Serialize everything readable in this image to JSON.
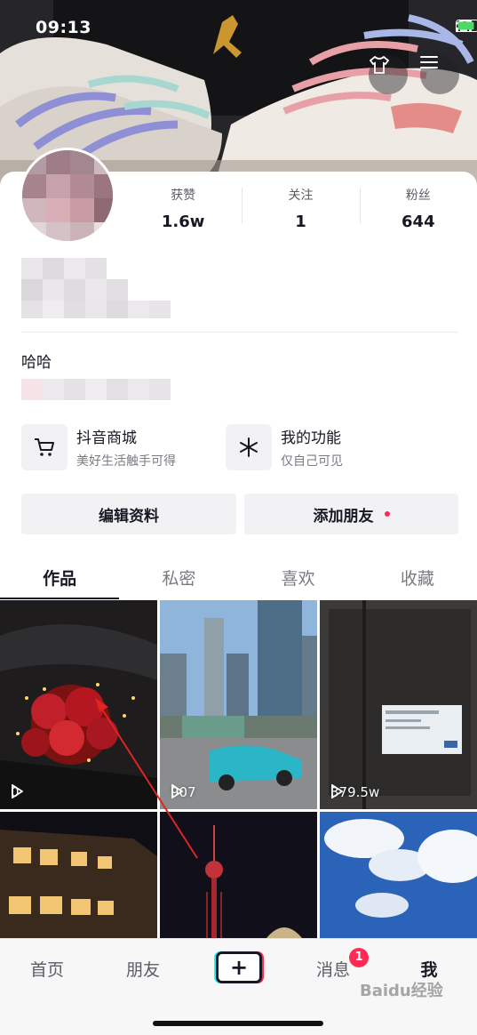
{
  "status_bar": {
    "time": "09:13"
  },
  "profile": {
    "stats": [
      {
        "label": "获赞",
        "value": "1.6w"
      },
      {
        "label": "关注",
        "value": "1"
      },
      {
        "label": "粉丝",
        "value": "644"
      }
    ],
    "bio_title": "哈哈"
  },
  "features": [
    {
      "icon": "cart-icon",
      "title": "抖音商城",
      "subtitle": "美好生活触手可得"
    },
    {
      "icon": "asterisk-icon",
      "title": "我的功能",
      "subtitle": "仅自己可见"
    }
  ],
  "buttons": {
    "edit_profile": "编辑资料",
    "add_friends": "添加朋友"
  },
  "tabs": [
    {
      "label": "作品",
      "active": true
    },
    {
      "label": "私密",
      "active": false
    },
    {
      "label": "喜欢",
      "active": false
    },
    {
      "label": "收藏",
      "active": false
    }
  ],
  "videos": [
    {
      "plays": "0"
    },
    {
      "plays": "907"
    },
    {
      "plays": "379.5w"
    },
    {
      "plays": ""
    },
    {
      "plays": ""
    },
    {
      "plays": ""
    }
  ],
  "nav": {
    "home": "首页",
    "friends": "朋友",
    "add": "+",
    "messages": "消息",
    "messages_badge": "1",
    "me": "我"
  },
  "watermark": "Baidu经验",
  "colors": {
    "accent": "#fe2c55",
    "text": "#161823",
    "secondary": "#7a7b82"
  }
}
